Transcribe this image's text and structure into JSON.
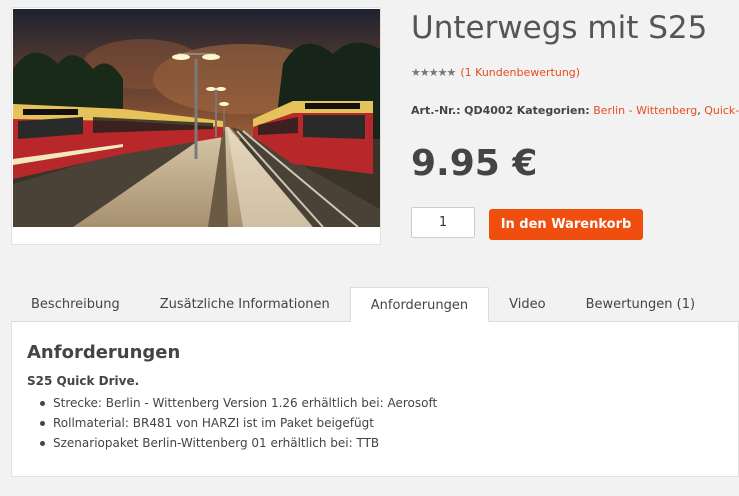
{
  "product": {
    "title": "Unterwegs mit S25",
    "rating_stars": 5,
    "review_link": "(1 Kundenbewertung)",
    "sku_label": "Art.-Nr.:",
    "sku": "QD4002",
    "categories_label": "Kategorien:",
    "categories": [
      "Berlin - Wittenberg",
      "Quick-Drive"
    ],
    "price": "9.95 €",
    "quantity": "1",
    "add_to_cart": "In den Warenkorb",
    "image_icon": "train-station-photo"
  },
  "tabs": [
    {
      "label": "Beschreibung",
      "active": false
    },
    {
      "label": "Zusätzliche Informationen",
      "active": false
    },
    {
      "label": "Anforderungen",
      "active": true
    },
    {
      "label": "Video",
      "active": false
    },
    {
      "label": "Bewertungen (1)",
      "active": false
    }
  ],
  "panel": {
    "title": "Anforderungen",
    "subtitle": "S25 Quick Drive.",
    "items": [
      "Strecke: Berlin - Wittenberg Version 1.26 erhältlich bei: Aerosoft",
      "Rollmaterial: BR481 von HARZI ist im Paket beigefügt",
      "Szenariopaket Berlin-Wittenberg 01 erhältlich bei: TTB"
    ]
  },
  "colors": {
    "accent": "#e84c1e",
    "button": "#f04e0f",
    "text": "#444444",
    "background": "#f2f2f2"
  }
}
